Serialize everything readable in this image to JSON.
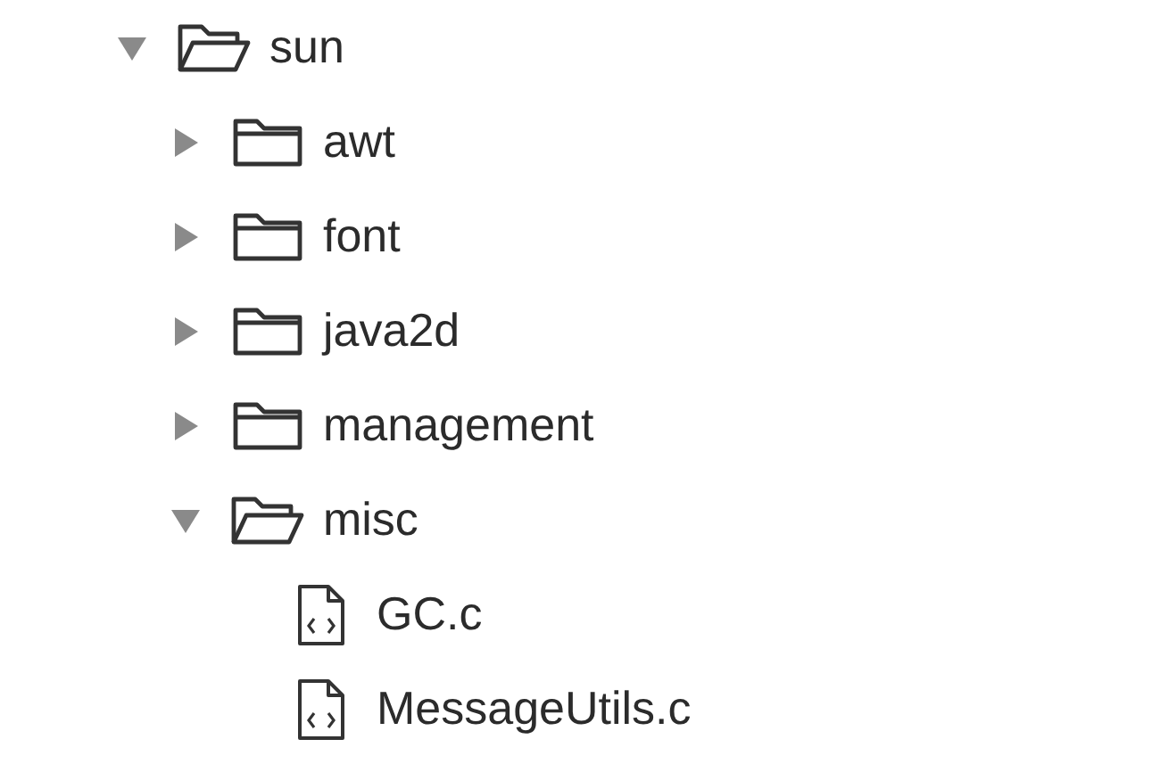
{
  "tree": [
    {
      "name": "sun",
      "kind": "folder",
      "expanded": true,
      "children": [
        {
          "name": "awt",
          "kind": "folder",
          "expanded": false
        },
        {
          "name": "font",
          "kind": "folder",
          "expanded": false
        },
        {
          "name": "java2d",
          "kind": "folder",
          "expanded": false
        },
        {
          "name": "management",
          "kind": "folder",
          "expanded": false
        },
        {
          "name": "misc",
          "kind": "folder",
          "expanded": true,
          "children": [
            {
              "name": "GC.c",
              "kind": "file"
            },
            {
              "name": "MessageUtils.c",
              "kind": "file"
            }
          ]
        }
      ]
    }
  ]
}
